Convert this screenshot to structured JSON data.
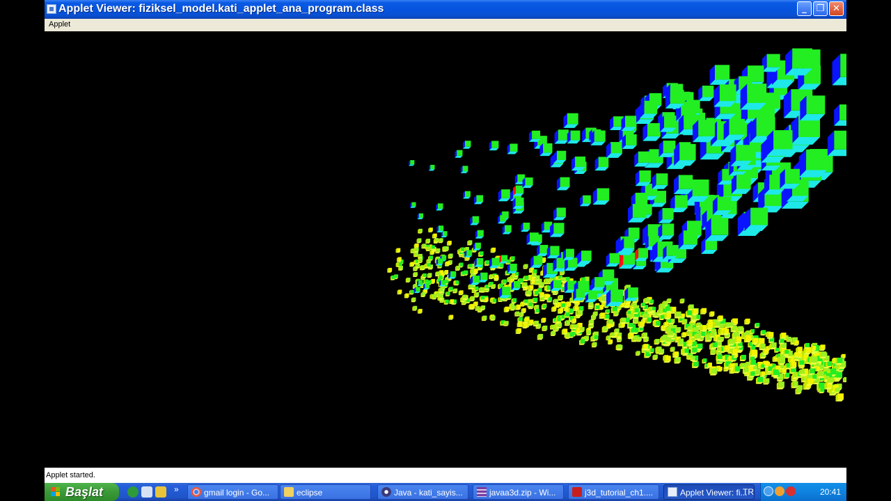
{
  "window": {
    "title": "Applet Viewer: fiziksel_model.kati_applet_ana_program.class",
    "menu": [
      "Applet"
    ],
    "status": "Applet started.",
    "controls": {
      "minimize": "_",
      "maximize": "❐",
      "close": "✕"
    }
  },
  "taskbar": {
    "start_label": "Başlat",
    "quick_more": "»",
    "tasks": [
      {
        "label": "gmail login - Go...",
        "icon": "chrome-icon"
      },
      {
        "label": "eclipse",
        "icon": "folder-icon"
      },
      {
        "label": "Java - kati_sayis...",
        "icon": "eclipse-icon"
      },
      {
        "label": "javaa3d.zip - Wi...",
        "icon": "winrar-icon"
      },
      {
        "label": "j3d_tutorial_ch1....",
        "icon": "pdf-icon"
      },
      {
        "label": "Applet Viewer: fi...",
        "icon": "java-icon",
        "active": true
      }
    ],
    "language": "TR",
    "clock": "20:41"
  },
  "colors": {
    "cube_green": "#22ee22",
    "cube_blue": "#0a14ff",
    "cube_cyan": "#1ee8e8",
    "cube_red": "#ff1010",
    "cube_yellow": "#f4f400"
  }
}
